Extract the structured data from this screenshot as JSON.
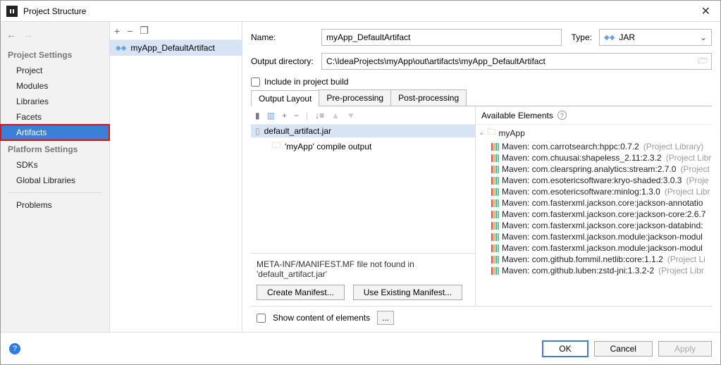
{
  "window": {
    "title": "Project Structure"
  },
  "sidebar": {
    "section1_title": "Project Settings",
    "items1": [
      "Project",
      "Modules",
      "Libraries",
      "Facets",
      "Artifacts"
    ],
    "selected": "Artifacts",
    "section2_title": "Platform Settings",
    "items2": [
      "SDKs",
      "Global Libraries"
    ],
    "items3": [
      "Problems"
    ]
  },
  "artifact_list": {
    "items": [
      {
        "name": "myApp_DefaultArtifact"
      }
    ]
  },
  "form": {
    "name_label": "Name:",
    "name_value": "myApp_DefaultArtifact",
    "type_label": "Type:",
    "type_value": "JAR",
    "outdir_label": "Output directory:",
    "outdir_value": "C:\\IdeaProjects\\myApp\\out\\artifacts\\myApp_DefaultArtifact",
    "include_label": "Include in project build"
  },
  "tabs": {
    "items": [
      "Output Layout",
      "Pre-processing",
      "Post-processing"
    ],
    "active": 0
  },
  "layout_tree": {
    "root": "default_artifact.jar",
    "child": "'myApp' compile output"
  },
  "manifest": {
    "message": "META-INF/MANIFEST.MF file not found in 'default_artifact.jar'",
    "create_btn": "Create Manifest...",
    "use_btn": "Use Existing Manifest..."
  },
  "available": {
    "header": "Available Elements",
    "root": "myApp",
    "libs": [
      {
        "name": "Maven: com.carrotsearch:hppc:0.7.2",
        "suffix": "(Project Library)"
      },
      {
        "name": "Maven: com.chuusai:shapeless_2.11:2.3.2",
        "suffix": "(Project Libr"
      },
      {
        "name": "Maven: com.clearspring.analytics:stream:2.7.0",
        "suffix": "(Project"
      },
      {
        "name": "Maven: com.esotericsoftware:kryo-shaded:3.0.3",
        "suffix": "(Proje"
      },
      {
        "name": "Maven: com.esotericsoftware:minlog:1.3.0",
        "suffix": "(Project Libr"
      },
      {
        "name": "Maven: com.fasterxml.jackson.core:jackson-annotatio",
        "suffix": ""
      },
      {
        "name": "Maven: com.fasterxml.jackson.core:jackson-core:2.6.7",
        "suffix": ""
      },
      {
        "name": "Maven: com.fasterxml.jackson.core:jackson-databind:",
        "suffix": ""
      },
      {
        "name": "Maven: com.fasterxml.jackson.module:jackson-modul",
        "suffix": ""
      },
      {
        "name": "Maven: com.fasterxml.jackson.module:jackson-modul",
        "suffix": ""
      },
      {
        "name": "Maven: com.github.fommil.netlib:core:1.1.2",
        "suffix": "(Project Li"
      },
      {
        "name": "Maven: com.github.luben:zstd-jni:1.3.2-2",
        "suffix": "(Project Libr"
      }
    ]
  },
  "show_content_label": "Show content of elements",
  "footer": {
    "ok": "OK",
    "cancel": "Cancel",
    "apply": "Apply"
  }
}
